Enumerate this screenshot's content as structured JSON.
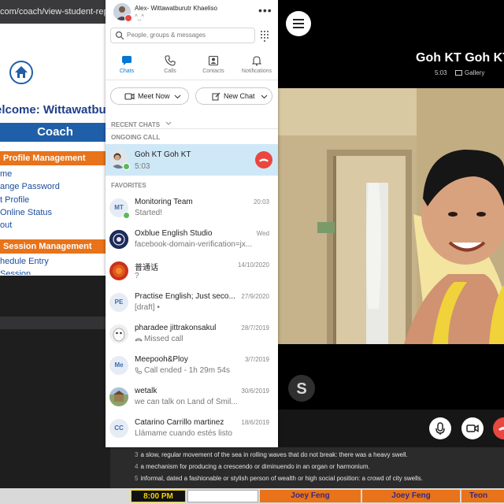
{
  "browser": {
    "url_text": "com/coach/view-student-report",
    "welcome": "elcome: Wittawatbu",
    "coach_label": "Coach",
    "profile_heading": "Profile Management",
    "profile_links": [
      "me",
      "ange Password",
      "t Profile",
      "Online Status",
      "out"
    ],
    "session_heading": "Session Management",
    "session_links": [
      "hedule Entry",
      "Session"
    ]
  },
  "skype": {
    "profile": {
      "name": "Alex- Wittawatburutr Khaeliso",
      "mood": "^_^",
      "more_icon": "more-horizontal-icon"
    },
    "search": {
      "placeholder": "People, groups & messages",
      "dialpad_icon": "dialpad-icon"
    },
    "nav": [
      {
        "label": "Chats",
        "icon": "chat-icon",
        "active": true
      },
      {
        "label": "Calls",
        "icon": "phone-icon",
        "active": false
      },
      {
        "label": "Contacts",
        "icon": "contacts-icon",
        "active": false
      },
      {
        "label": "Notifications",
        "icon": "bell-icon",
        "active": false
      }
    ],
    "meet_now_label": "Meet Now",
    "new_chat_label": "New Chat",
    "recent_chats_label": "RECENT CHATS",
    "ongoing_call_label": "ONGOING CALL",
    "ongoing_call": {
      "name": "Goh KT Goh KT",
      "time": "5:03"
    },
    "favorites_label": "FAVORITES",
    "favorites": [
      {
        "name": "Monitoring Team",
        "initials": "MT",
        "sub": "Started!",
        "date": "20:03"
      },
      {
        "name": "Oxblue English Studio",
        "initials": "",
        "sub": "facebook-domain-verification=jx...",
        "date": "Wed"
      },
      {
        "name": "普通话",
        "initials": "",
        "sub": "?",
        "date": "14/10/2020"
      },
      {
        "name": "Practise English; Just seco...",
        "initials": "PE",
        "sub": "[draft] •",
        "date": "27/9/2020"
      },
      {
        "name": "pharadee jittrakonsakul",
        "initials": "",
        "sub": "Missed call",
        "date": "28/7/2019"
      },
      {
        "name": "Meepooh&Ploy",
        "initials": "Me",
        "sub": "Call ended - 1h 29m 54s",
        "date": "3/7/2019"
      },
      {
        "name": "wetalk",
        "initials": "",
        "sub": "we can talk on Land of Smil...",
        "date": "30/6/2019"
      },
      {
        "name": "Catarino Carrillo martinez",
        "initials": "CC",
        "sub": "Llámame cuando estés listo",
        "date": "18/6/2019"
      }
    ]
  },
  "call": {
    "caller": "Goh KT Goh KT",
    "duration": "5:03",
    "gallery_label": "Gallery",
    "accent": "#e9473f"
  },
  "dictionary": [
    {
      "num": "3",
      "text": "a slow, regular movement of the sea in rolling waves that do not break: there was a heavy swell."
    },
    {
      "num": "4",
      "text": "a mechanism for producing a crescendo or diminuendo in an organ or harmonium."
    },
    {
      "num": "5",
      "text": "informal, dated a fashionable or stylish person of wealth or high social position: a crowd of city swells."
    }
  ],
  "timetable": {
    "time": "8:00 PM",
    "cells": [
      "Joey Feng",
      "Joey Feng",
      "Teon"
    ]
  },
  "colors": {
    "skype_blue": "#0078d4",
    "selected_row": "#cfe8f7",
    "end_call_red": "#e9473f"
  }
}
